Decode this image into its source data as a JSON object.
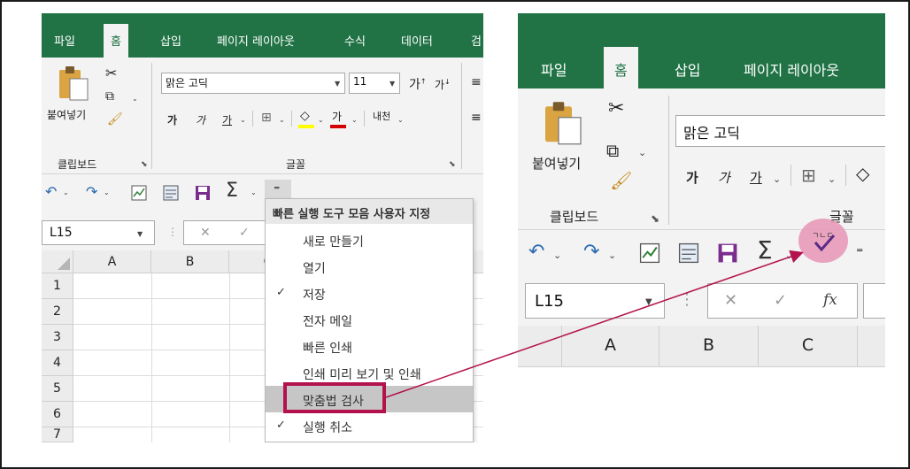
{
  "left": {
    "tabs": [
      "파일",
      "홈",
      "삽입",
      "페이지 레이아웃",
      "수식",
      "데이터",
      "검"
    ],
    "clipboard": {
      "paste_label": "붙여넣기",
      "group_label": "클립보드"
    },
    "font": {
      "name": "맑은 고딕",
      "size": "11",
      "group_label": "글꼴",
      "bold": "가",
      "italic": "가",
      "underline": "가",
      "font_color_glyph": "가",
      "phonetic_glyph": "내천"
    },
    "qat": {
      "undo": "↶",
      "redo": "↷",
      "customize": "⁼"
    },
    "namebox": "L15",
    "formula_cancel": "✕",
    "formula_enter": "✓",
    "columns": [
      "A",
      "B",
      "C"
    ],
    "rows": [
      "1",
      "2",
      "3",
      "4",
      "5",
      "6",
      "7"
    ],
    "menu": {
      "header": "빠른 실행 도구 모음 사용자 지정",
      "items": [
        {
          "label": "새로 만들기",
          "checked": ""
        },
        {
          "label": "열기",
          "checked": ""
        },
        {
          "label": "저장",
          "checked": "✓"
        },
        {
          "label": "전자 메일",
          "checked": ""
        },
        {
          "label": "빠른 인쇄",
          "checked": ""
        },
        {
          "label": "인쇄 미리 보기 및 인쇄",
          "checked": ""
        },
        {
          "label": "맞춤법 검사",
          "checked": ""
        },
        {
          "label": "실행 취소",
          "checked": "✓"
        }
      ]
    }
  },
  "right": {
    "tabs": [
      "파일",
      "홈",
      "삽입",
      "페이지 레이아웃"
    ],
    "clipboard": {
      "paste_label": "붙여넣기",
      "group_label": "클립보드"
    },
    "font": {
      "name": "맑은 고딕",
      "group_label": "글꼴",
      "bold": "가",
      "italic": "가",
      "underline": "가"
    },
    "qat": {
      "undo": "↶",
      "redo": "↷",
      "sum": "Σ",
      "customize": "⁼"
    },
    "namebox": "L15",
    "formula_cancel": "✕",
    "formula_enter": "✓",
    "fx": "fx",
    "columns": [
      "A",
      "B",
      "C"
    ]
  },
  "colors": {
    "excel_green": "#217346",
    "highlight_box": "#b3124d",
    "callout_circle": "#e89ab8",
    "arrow": "#b3124d"
  }
}
